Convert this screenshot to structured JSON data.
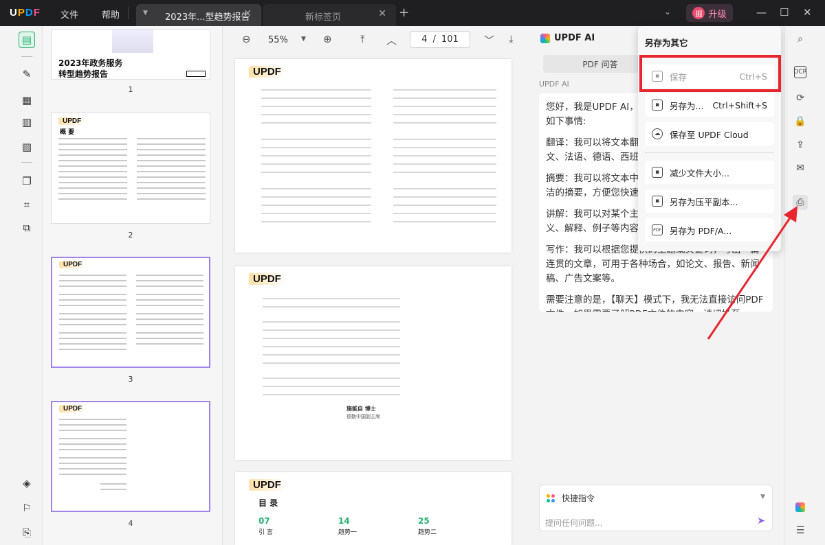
{
  "window": {
    "logo": "UPDF",
    "menu": [
      "文件",
      "帮助"
    ],
    "tabs": [
      {
        "label": "2023年...型趋势报告",
        "active": true
      },
      {
        "label": "新标签页",
        "active": false
      }
    ],
    "upgrade": {
      "avatar": "掘",
      "label": "升级"
    }
  },
  "thumbnails": {
    "pages": [
      {
        "number": "1",
        "title_line1": "2023年政务服务",
        "title_line2": "转型趋势报告"
      },
      {
        "number": "2",
        "title": "概 要"
      },
      {
        "number": "3"
      },
      {
        "number": "4"
      }
    ]
  },
  "toolbar": {
    "zoom": "55%",
    "current_page": "4",
    "total_pages": "101"
  },
  "document": {
    "page2": {
      "logo": "UPDF"
    },
    "page3": {
      "logo": "UPDF",
      "sig_name": "施能自  博士",
      "sig_org": "德勤中国副主席"
    },
    "page4": {
      "logo": "UPDF",
      "toc_title": "目 录",
      "toc": [
        {
          "num": "07",
          "label": "引 言"
        },
        {
          "num": "14",
          "label": "趋势一"
        },
        {
          "num": "25",
          "label": "趋势二"
        }
      ]
    }
  },
  "ai_panel": {
    "title": "UPDF AI",
    "tab_label": "PDF 问答",
    "speaker": "UPDF AI",
    "messages": [
      "您好，我是UPDF AI，您的智能助手，可以帮助您做如下事情:",
      "翻译：我可以将文本翻译成多种语言，包括英文、中文、法语、德语、西班牙语等。",
      "摘要：我可以将文本中的关键信息提取出来，形成简洁的摘要，方便您快速了解文本内容。",
      "讲解：我可以对某个主题进行详细的讲解，包括定义、解释、例子等内容，帮助您理解。",
      "写作：我可以根据您提供的主题或关键词，写出一篇连贯的文章，可用于各种场合，如论文、报告、新闻稿、广告文案等。",
      "需要注意的是，【聊天】模式下，我无法直接访问PDF文件，如果需要了解PDF文件的内容，请切换至【PDF问答】模式。"
    ],
    "quick_commands": "快捷指令",
    "input_placeholder": "提问任何问题..."
  },
  "save_popup": {
    "header": "另存为其它",
    "items": [
      {
        "label": "保存",
        "shortcut": "Ctrl+S",
        "disabled": true
      },
      {
        "label": "另存为...",
        "shortcut": "Ctrl+Shift+S",
        "disabled": false
      },
      {
        "label": "保存至 UPDF Cloud",
        "shortcut": "",
        "disabled": false
      },
      {
        "label": "减少文件大小...",
        "shortcut": "",
        "disabled": false
      },
      {
        "label": "另存为压平副本...",
        "shortcut": "",
        "disabled": false
      },
      {
        "label": "另存为 PDF/A...",
        "shortcut": "",
        "disabled": false
      }
    ]
  },
  "colors": {
    "accent_green": "#27b074",
    "highlight_red": "#e8242f",
    "ai_purple": "#8b62f0"
  }
}
